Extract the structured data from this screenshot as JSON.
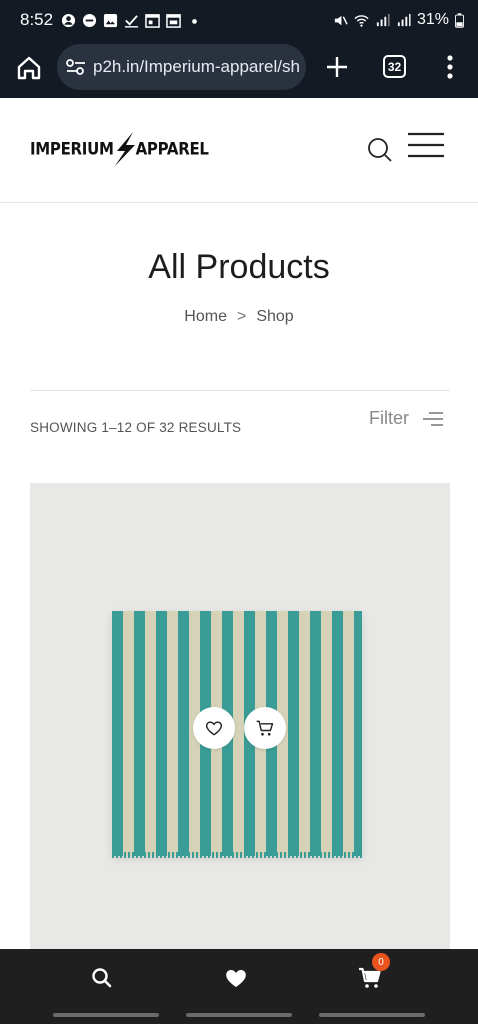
{
  "status_bar": {
    "time": "8:52",
    "battery": "31%",
    "notification_icons": [
      "account-icon",
      "app-icon",
      "image-icon",
      "check-icon",
      "calendar-icon",
      "calendar-icon",
      "dot-icon"
    ],
    "system_icons": [
      "mute-icon",
      "wifi-icon",
      "signal-icon",
      "signal-icon",
      "battery-icon"
    ]
  },
  "browser": {
    "url": "p2h.in/Imperium-apparel/sh",
    "tab_count": "32"
  },
  "header": {
    "logo_left": "IMPERIUM",
    "logo_right": "APPAREL"
  },
  "page": {
    "title": "All Products",
    "breadcrumb": {
      "home": "Home",
      "separator": ">",
      "current": "Shop"
    },
    "results": "SHOWING 1–12 OF 32 RESULTS",
    "filter_label": "Filter"
  },
  "product": {
    "stripe_colors": [
      "#3a9c96",
      "#d6d2b8"
    ]
  },
  "bottom_nav": {
    "cart_count": "0",
    "items": [
      "search-icon",
      "heart-icon",
      "cart-icon"
    ]
  },
  "colors": {
    "browser_bg": "#131a24",
    "accent_badge": "#e8531e",
    "bottom_nav_bg": "#1f1f1f"
  }
}
